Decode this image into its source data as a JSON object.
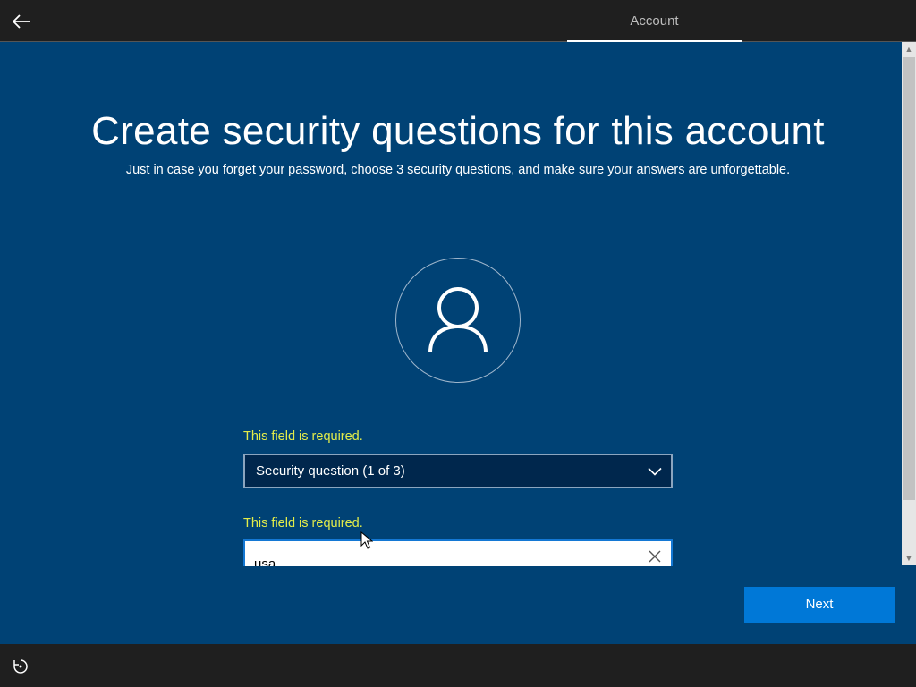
{
  "header": {
    "back_icon": "back-arrow-icon",
    "active_tab": "Account"
  },
  "page": {
    "title": "Create security questions for this account",
    "subtitle": "Just in case you forget your password, choose 3 security questions, and make sure your answers are unforgettable.",
    "avatar_icon": "user-icon"
  },
  "form": {
    "question_error": "This field is required.",
    "question_select": {
      "value": "Security question (1 of 3)",
      "icon": "chevron-down-icon"
    },
    "answer_error": "This field is required.",
    "answer_input": {
      "value": "usa",
      "clear_icon": "close-icon"
    }
  },
  "actions": {
    "next_label": "Next"
  },
  "footer": {
    "ease_of_access_icon": "ease-of-access-icon"
  },
  "colors": {
    "main_background": "#004275",
    "bar_background": "#1f1f1f",
    "accent": "#0078d7",
    "error_text": "#e2ec4a"
  }
}
